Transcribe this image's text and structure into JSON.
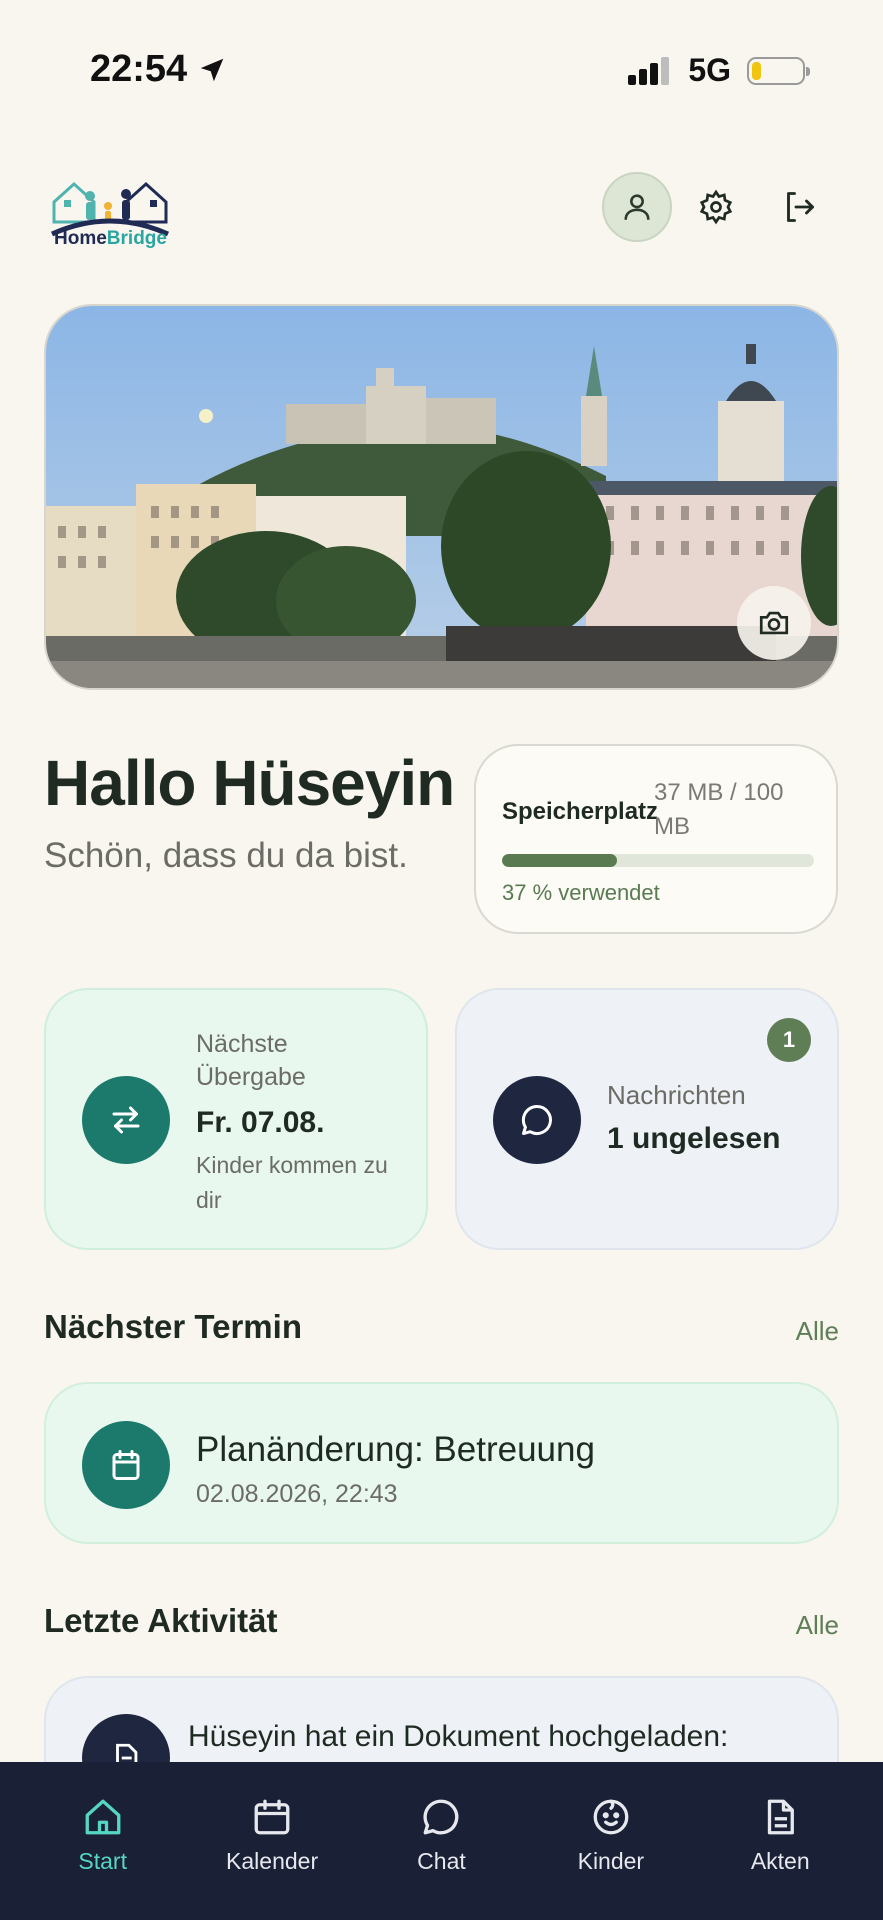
{
  "status_bar": {
    "time": "22:54",
    "network": "5G"
  },
  "header": {
    "logo_home": "Home",
    "logo_bridge": "Bridge"
  },
  "greeting": {
    "title": "Hallo Hüseyin",
    "subtitle": "Schön, dass du da bist."
  },
  "storage": {
    "label": "Speicherplatz",
    "value": "37 MB / 100 MB",
    "used_percent_label": "37 % verwendet",
    "used_fraction": 0.37
  },
  "handover": {
    "label": "Nächste Übergabe",
    "date": "Fr. 07.08.",
    "note": "Kinder kommen zu dir"
  },
  "messages": {
    "label": "Nachrichten",
    "value": "1 ungelesen",
    "badge": "1"
  },
  "next_event": {
    "section_title": "Nächster Termin",
    "all_link": "Alle",
    "title": "Planänderung: Betreuung",
    "datetime": "02.08.2026, 22:43"
  },
  "activity": {
    "section_title": "Letzte Aktivität",
    "all_link": "Alle",
    "text": "Hüseyin hat ein Dokument hochgeladen:"
  },
  "tabs": [
    {
      "label": "Start",
      "icon": "home-icon",
      "active": true
    },
    {
      "label": "Kalender",
      "icon": "calendar-icon",
      "active": false
    },
    {
      "label": "Chat",
      "icon": "chat-icon",
      "active": false
    },
    {
      "label": "Kinder",
      "icon": "child-face-icon",
      "active": false
    },
    {
      "label": "Akten",
      "icon": "document-icon",
      "active": false
    }
  ],
  "colors": {
    "accent_teal": "#1b7a6c",
    "navy": "#1f2640",
    "active_tab": "#55d6c2",
    "sage": "#5f7e56"
  }
}
